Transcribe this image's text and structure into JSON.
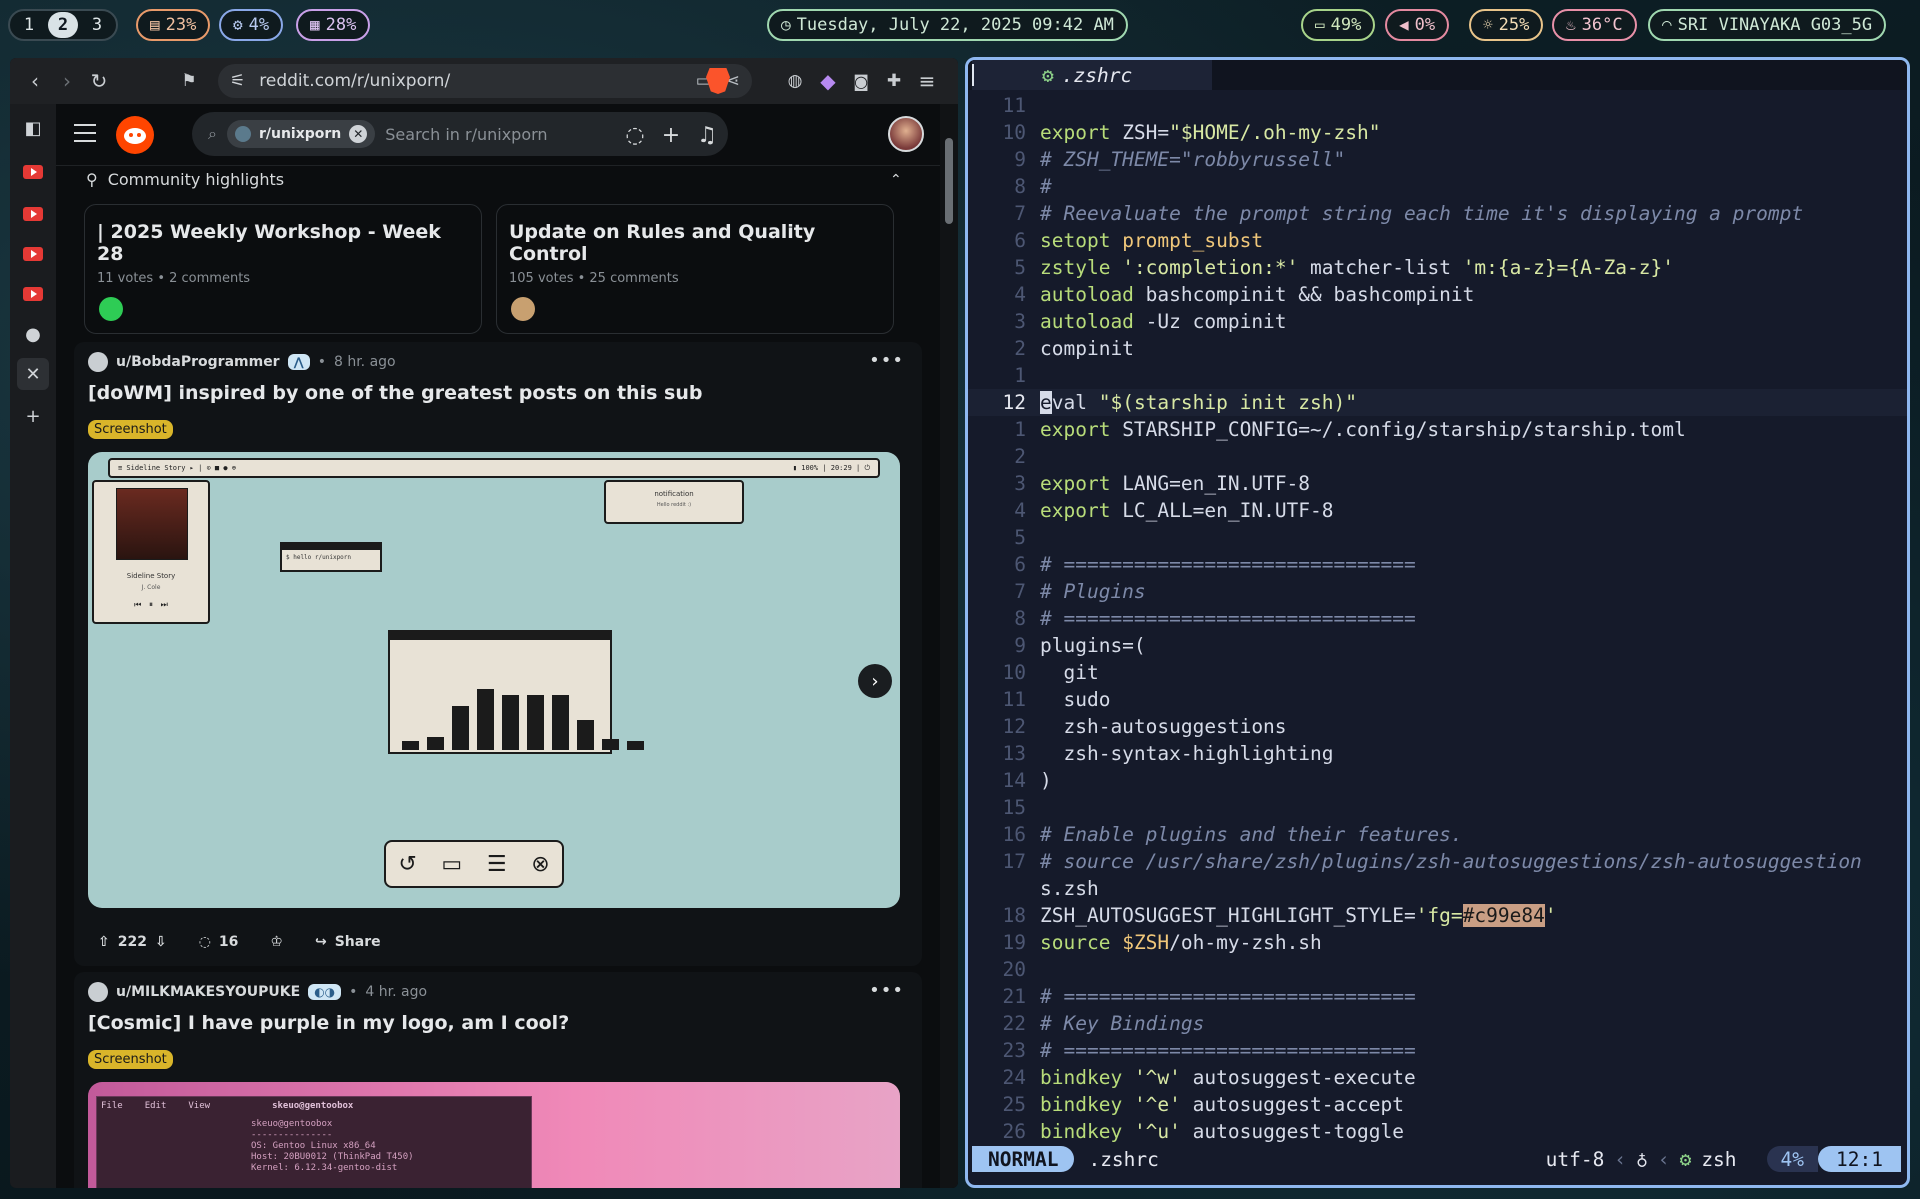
{
  "topbar": {
    "workspaces": [
      "1",
      "2",
      "3"
    ],
    "active_workspace": "2",
    "cpu": "23%",
    "ram": "4%",
    "disk": "28%",
    "datetime": "Tuesday, July 22, 2025 09:42 AM",
    "battery": "49%",
    "volume": "0%",
    "brightness": "25%",
    "temperature": "36°C",
    "wifi": "SRI VINAYAKA G03_5G"
  },
  "browser": {
    "url": "reddit.com/r/unixporn/",
    "search_chip": "r/unixporn",
    "search_placeholder": "Search in r/unixporn",
    "community_highlights": "Community highlights",
    "highlights": [
      {
        "title": "| 2025 Weekly Workshop - Week 28",
        "meta": "11 votes • 2 comments"
      },
      {
        "title": "Update on Rules and Quality Control",
        "meta": "105 votes • 25 comments"
      }
    ],
    "posts": [
      {
        "user": "u/BobdaProgrammer",
        "age": "8 hr. ago",
        "title": "[doWM] inspired by one of the greatest posts on this sub",
        "flair": "Screenshot",
        "votes": "222",
        "comments": "16",
        "share": "Share",
        "image": {
          "bar_left": "≡ Sideline Story ▸ | ⊙ ■ ● ⊕",
          "bar_right": "▮ 100% | 20:29 | ⏻",
          "player_title": "Sideline Story",
          "player_sub": "J. Cole",
          "terminal_text": "$ hello r/unixporn",
          "notification_title": "notification",
          "notification_body": "Hello reddit :)",
          "bar_heights": [
            0.08,
            0.12,
            0.4,
            0.55,
            0.5,
            0.5,
            0.5,
            0.27,
            0.1,
            0.08
          ]
        }
      },
      {
        "user": "u/MILKMAKESYOUPUKE",
        "age": "4 hr. ago",
        "title": "[Cosmic] I have purple in my logo, am I cool?",
        "flair": "Screenshot",
        "terminal_header": [
          "File",
          "Edit",
          "View"
        ],
        "terminal_title": "skeuo@gentoobox",
        "terminal_info": [
          "skeuo@gentoobox",
          "---------------",
          "OS: Gentoo Linux x86_64",
          "Host: 20BU0012 (ThinkPad T450)",
          "Kernel: 6.12.34-gentoo-dist"
        ]
      }
    ]
  },
  "editor": {
    "tab_name": ".zshrc",
    "lines": [
      {
        "n": "11",
        "t": ""
      },
      {
        "n": "10",
        "t": "export ZSH=\"$HOME/.oh-my-zsh\""
      },
      {
        "n": "9",
        "t": "# ZSH_THEME=\"robbyrussell\""
      },
      {
        "n": "8",
        "t": "#"
      },
      {
        "n": "7",
        "t": "# Reevaluate the prompt string each time it's displaying a prompt"
      },
      {
        "n": "6",
        "t": "setopt prompt_subst"
      },
      {
        "n": "5",
        "t": "zstyle ':completion:*' matcher-list 'm:{a-z}={A-Za-z}'"
      },
      {
        "n": "4",
        "t": "autoload bashcompinit && bashcompinit"
      },
      {
        "n": "3",
        "t": "autoload -Uz compinit"
      },
      {
        "n": "2",
        "t": "compinit"
      },
      {
        "n": "1",
        "t": ""
      },
      {
        "n": "12",
        "t": "eval \"$(starship init zsh)\""
      },
      {
        "n": "1",
        "t": "export STARSHIP_CONFIG=~/.config/starship/starship.toml"
      },
      {
        "n": "2",
        "t": ""
      },
      {
        "n": "3",
        "t": "export LANG=en_IN.UTF-8"
      },
      {
        "n": "4",
        "t": "export LC_ALL=en_IN.UTF-8"
      },
      {
        "n": "5",
        "t": ""
      },
      {
        "n": "6",
        "t": "# =============================="
      },
      {
        "n": "7",
        "t": "# Plugins"
      },
      {
        "n": "8",
        "t": "# =============================="
      },
      {
        "n": "9",
        "t": "plugins=("
      },
      {
        "n": "10",
        "t": "  git"
      },
      {
        "n": "11",
        "t": "  sudo"
      },
      {
        "n": "12",
        "t": "  zsh-autosuggestions"
      },
      {
        "n": "13",
        "t": "  zsh-syntax-highlighting"
      },
      {
        "n": "14",
        "t": ")"
      },
      {
        "n": "15",
        "t": ""
      },
      {
        "n": "16",
        "t": "# Enable plugins and their features."
      },
      {
        "n": "17",
        "t": "# source /usr/share/zsh/plugins/zsh-autosuggestions/zsh-autosuggestion"
      },
      {
        "n": "",
        "t": "s.zsh"
      },
      {
        "n": "18",
        "t": "ZSH_AUTOSUGGEST_HIGHLIGHT_STYLE='fg=#c99e84'"
      },
      {
        "n": "19",
        "t": "source $ZSH/oh-my-zsh.sh"
      },
      {
        "n": "20",
        "t": ""
      },
      {
        "n": "21",
        "t": "# =============================="
      },
      {
        "n": "22",
        "t": "# Key Bindings"
      },
      {
        "n": "23",
        "t": "# =============================="
      },
      {
        "n": "24",
        "t": "bindkey '^w' autosuggest-execute"
      },
      {
        "n": "25",
        "t": "bindkey '^e' autosuggest-accept"
      },
      {
        "n": "26",
        "t": "bindkey '^u' autosuggest-toggle"
      }
    ],
    "current_line_index": 11,
    "status": {
      "mode": "NORMAL",
      "file": ".zshrc",
      "encoding": "utf-8",
      "filetype": "zsh",
      "percent": "4%",
      "position": "12:1"
    }
  },
  "colors": {
    "keyword": "#b8dc7a",
    "comment": "#7d89a8",
    "accent": "#9ec4f2",
    "highlight": "#c99e84"
  }
}
